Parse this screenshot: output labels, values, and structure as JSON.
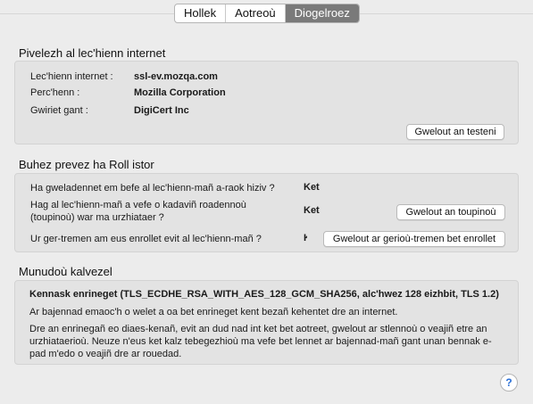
{
  "tabs": [
    {
      "label": "Hollek"
    },
    {
      "label": "Aotreoù"
    },
    {
      "label": "Diogelroez"
    }
  ],
  "identity": {
    "title": "Pivelezh al lec'hienn internet",
    "website_label": "Lec'hienn internet :",
    "website_value": "ssl-ev.mozqa.com",
    "owner_label": "Perc'henn :",
    "owner_value": "Mozilla Corporation",
    "verifier_label": "Gwiriet gant :",
    "verifier_value": "DigiCert Inc",
    "view_cert_button": "Gwelout an testeni"
  },
  "privacy": {
    "title": "Buhez prevez ha Roll istor",
    "q1": "Ha gweladennet em befe al lec'hienn-mañ a-raok hiziv ?",
    "a1": "Ket",
    "q2": "Hag al lec'hienn-mañ a vefe o kadaviñ roadennoù (toupinoù) war ma urzhiataer ?",
    "a2": "Ket",
    "cookies_button": "Gwelout an toupinoù",
    "q3": "Ur ger-tremen am eus enrollet evit al lec'hienn-mañ ?",
    "a3": "Ket",
    "passwords_button": "Gwelout ar gerioù-tremen bet enrollet"
  },
  "technical": {
    "title": "Munudoù kalvezel",
    "encryption": "Kennask enrineget (TLS_ECDHE_RSA_WITH_AES_128_GCM_SHA256, alc'hwez 128 eizhbit, TLS 1.2)",
    "para1": "Ar bajennad emaoc'h o welet a oa bet enrineget kent bezañ kehentet dre an internet.",
    "para2": "Dre an enrinegañ eo diaes-kenañ, evit an dud nad int ket bet aotreet, gwelout ar stlennoù o veajiñ etre an urzhiataerioù. Neuze n'eus ket kalz tebegezhioù ma vefe bet lennet ar bajennad-mañ gant unan bennak e-pad m'edo o veajiñ dre ar rouedad."
  },
  "help_icon": "help-icon",
  "colors": {
    "active_tab": "#7a7a7a",
    "help": "#2a6fd6"
  }
}
